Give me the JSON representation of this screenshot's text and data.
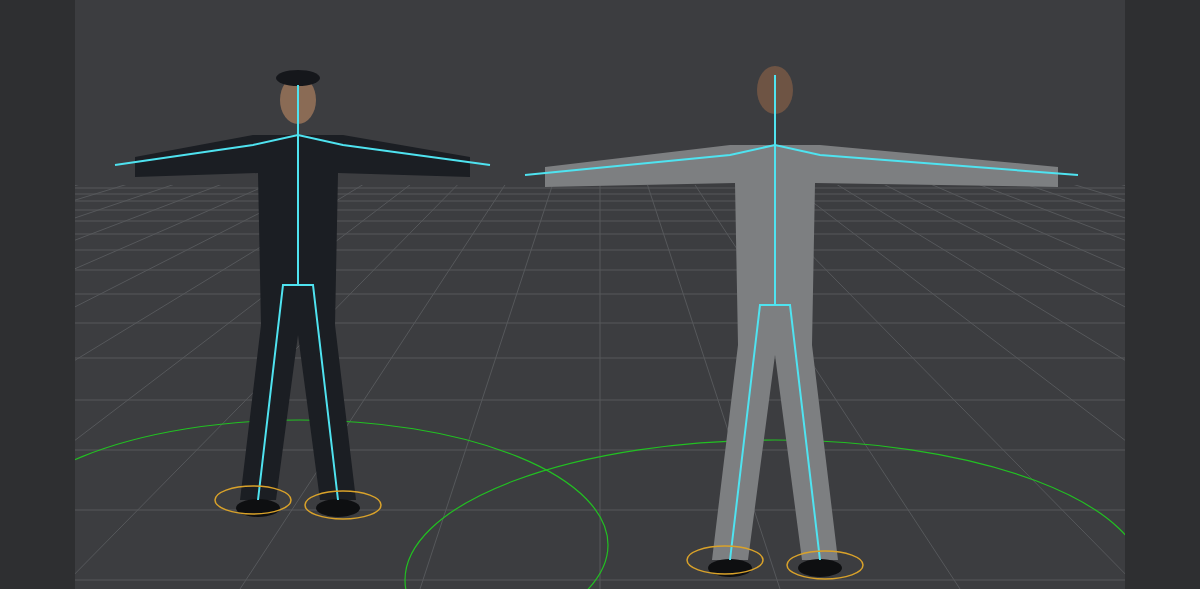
{
  "viewport": {
    "characters": [
      {
        "kind": "uniform"
      },
      {
        "kind": "casual"
      }
    ]
  }
}
